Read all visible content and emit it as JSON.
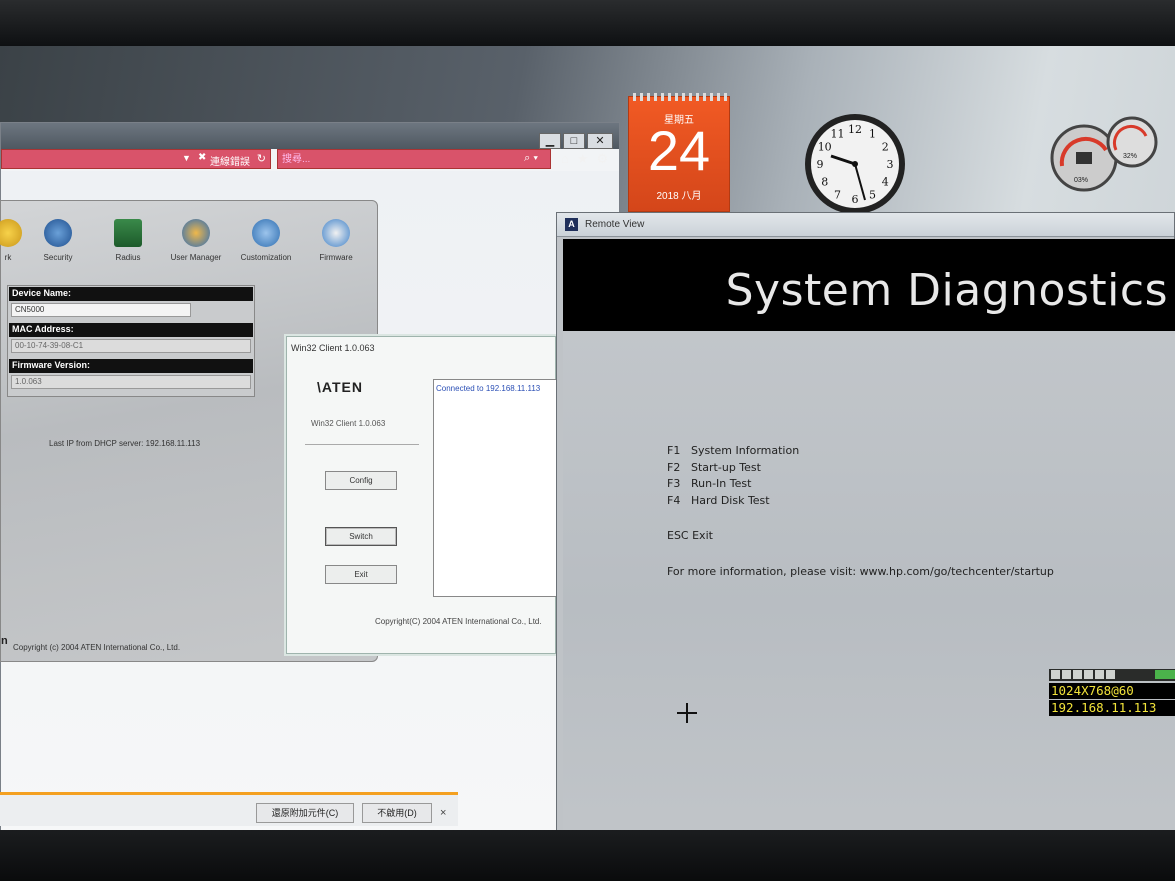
{
  "browser": {
    "tab_label": "連線錯誤",
    "search_placeholder": "搜尋...",
    "window_controls": [
      "▁",
      "□",
      "✕"
    ],
    "toolbar_icons": [
      "home-icon",
      "star-icon",
      "gear-icon"
    ]
  },
  "admin": {
    "toolbar": [
      "rk",
      "Security",
      "Radius",
      "User Manager",
      "Customization",
      "Firmware"
    ],
    "fields": {
      "device_name_label": "Device Name:",
      "device_name_value": "CN5000",
      "mac_label": "MAC Address:",
      "mac_value": "00-10-74-39-08-C1",
      "firmware_label": "Firmware Version:",
      "firmware_value": "1.0.063"
    },
    "dhcp_text": "Last IP from DHCP server: 192.168.11.113",
    "copyright": "Copyright (c) 2004 ATEN International Co., Ltd.",
    "aten_mark": "n"
  },
  "win32": {
    "title": "Win32 Client 1.0.063",
    "logo": "\\ATEN",
    "version": "Win32 Client 1.0.063",
    "buttons": {
      "config": "Config",
      "switch": "Switch",
      "exit": "Exit"
    },
    "log": "Connected to 192.168.11.113",
    "copyright": "Copyright(C) 2004 ATEN International Co., Ltd."
  },
  "notification": {
    "enable_addon": "還原附加元件(C)",
    "disable": "不啟用(D)",
    "close": "×"
  },
  "calendar": {
    "weekday": "星期五",
    "date": "24",
    "month": "2018 八月"
  },
  "clock": {
    "numerals": [
      "12",
      "1",
      "2",
      "3",
      "4",
      "5",
      "6",
      "7",
      "8",
      "9",
      "10",
      "11"
    ]
  },
  "meters": {
    "cpu": "03%",
    "ram": "32%"
  },
  "remote": {
    "title": "Remote View",
    "icon_letter": "A",
    "screen_title": "System Diagnostics",
    "menu": [
      {
        "key": "F1",
        "label": "System Information"
      },
      {
        "key": "F2",
        "label": "Start-up Test"
      },
      {
        "key": "F3",
        "label": "Run-In Test"
      },
      {
        "key": "F4",
        "label": "Hard Disk Test"
      }
    ],
    "esc": "ESC Exit",
    "info": "For more information, please visit: www.hp.com/go/techcenter/startup",
    "osd_resolution": "1024X768@60",
    "osd_ip": "192.168.11.113"
  }
}
